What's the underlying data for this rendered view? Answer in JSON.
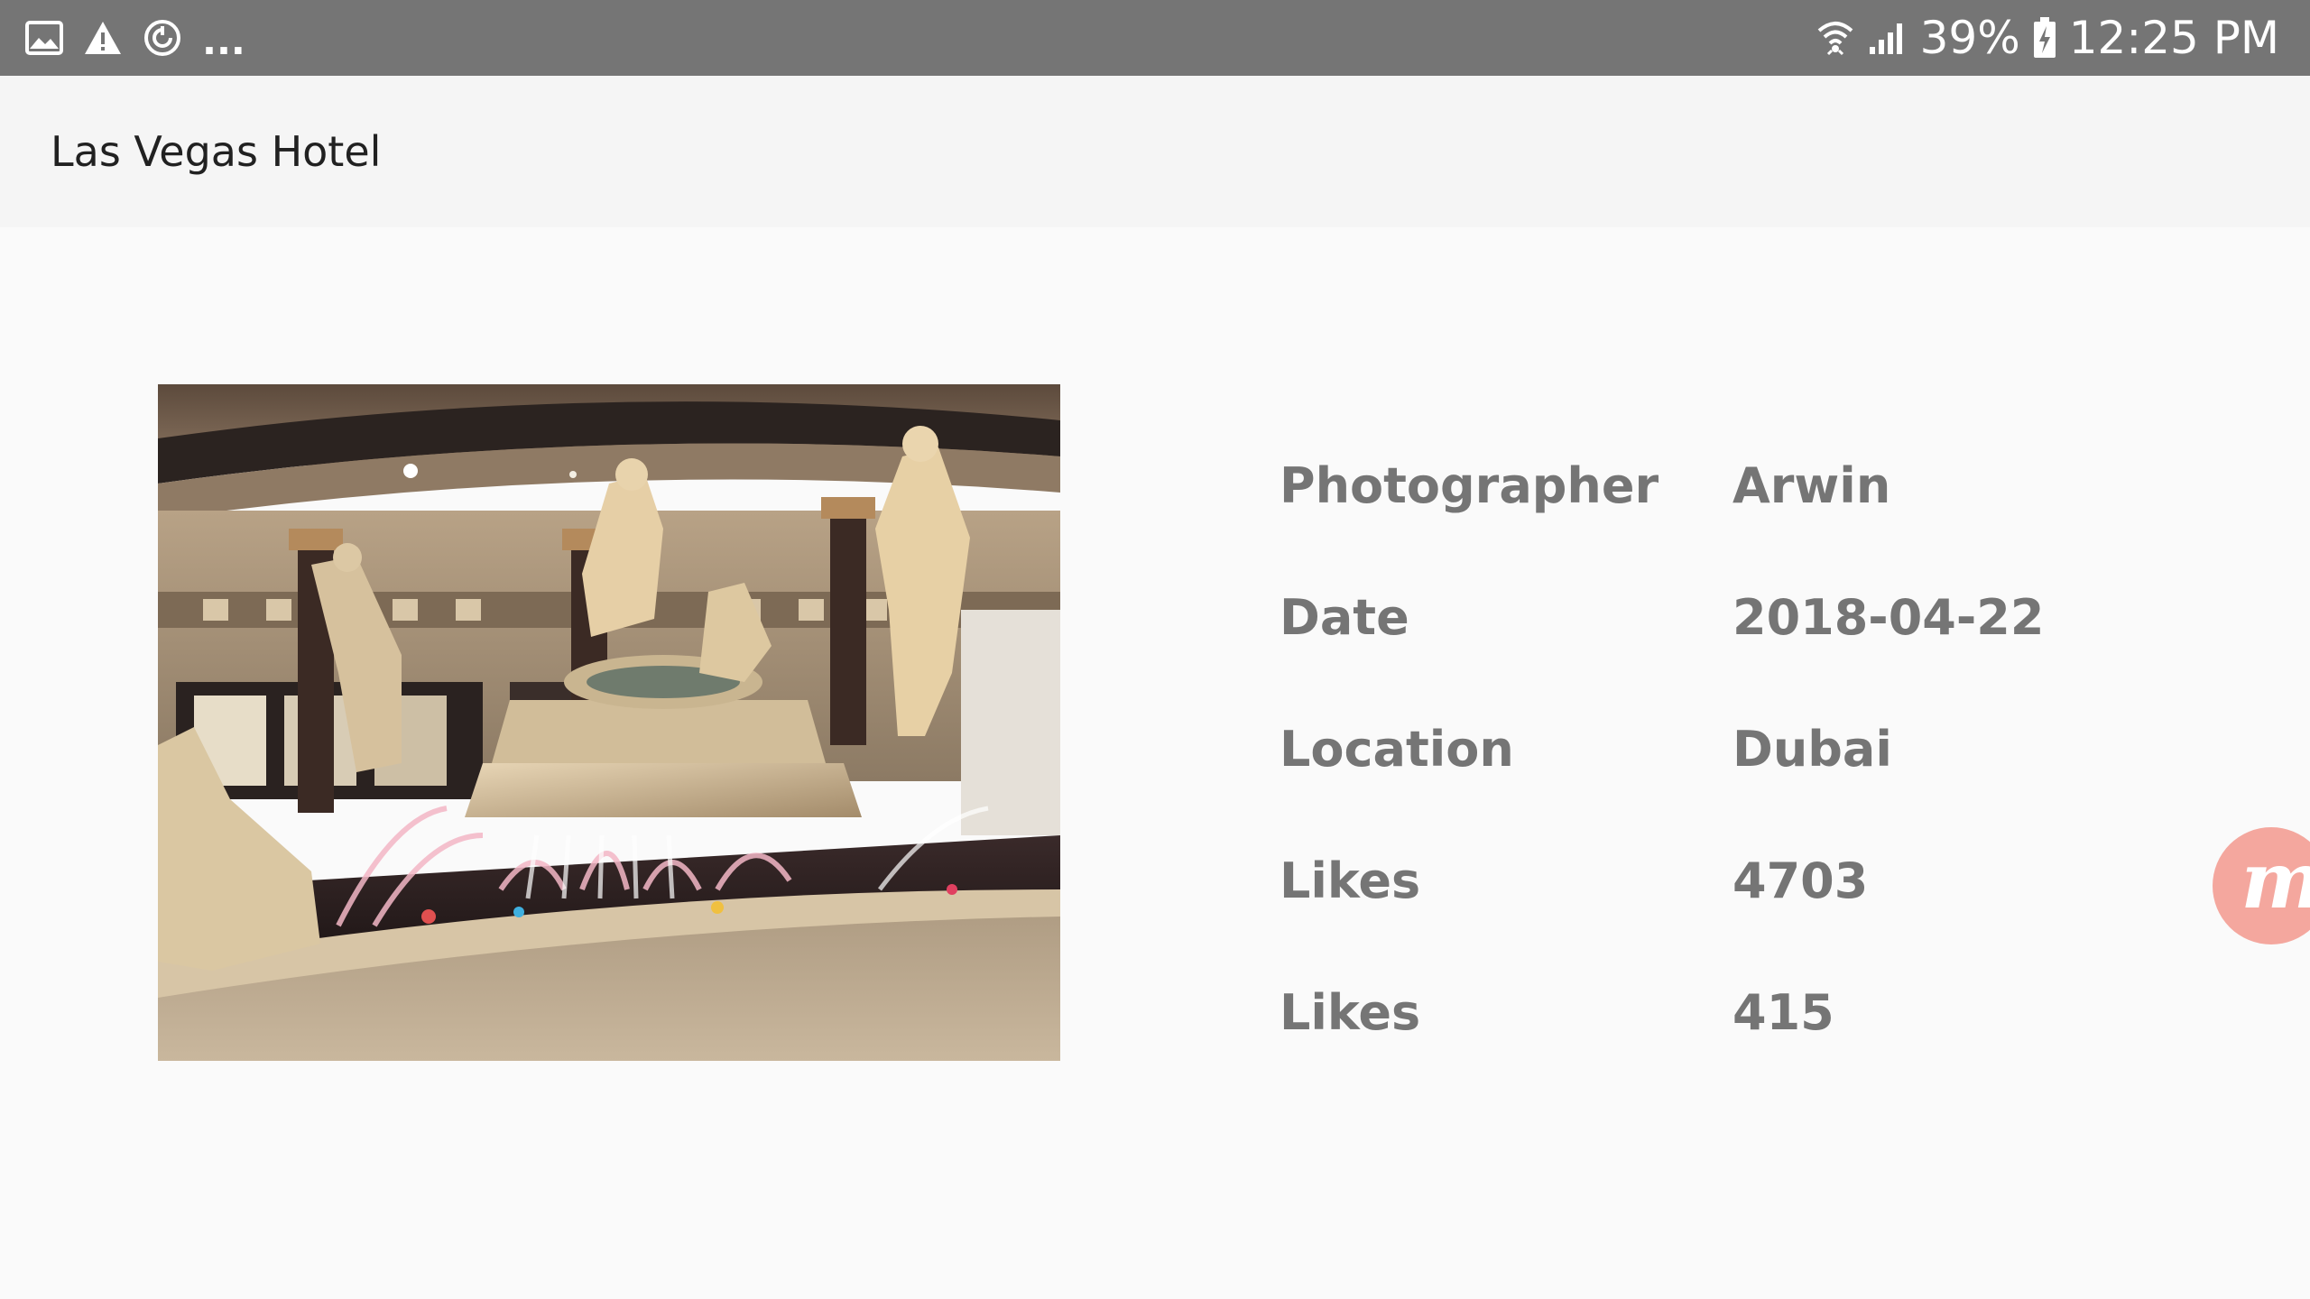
{
  "status_bar": {
    "notification_icons": [
      "gallery-icon",
      "warning-icon",
      "sync-icon"
    ],
    "overflow": "...",
    "battery_percent": "39%",
    "time": "12:25 PM",
    "colors": {
      "background": "#757575",
      "foreground": "#ffffff"
    }
  },
  "app_bar": {
    "title": "Las Vegas Hotel"
  },
  "photo": {
    "icon": "photo-fountain-statues"
  },
  "details": [
    {
      "label": "Photographer",
      "value": "Arwin"
    },
    {
      "label": "Date",
      "value": "2018-04-22"
    },
    {
      "label": "Location",
      "value": "Dubai"
    },
    {
      "label": "Likes",
      "value": "4703"
    },
    {
      "label": "Likes",
      "value": "415"
    }
  ],
  "floating_bubble": {
    "glyph": "m",
    "color": "#f4a79e"
  }
}
